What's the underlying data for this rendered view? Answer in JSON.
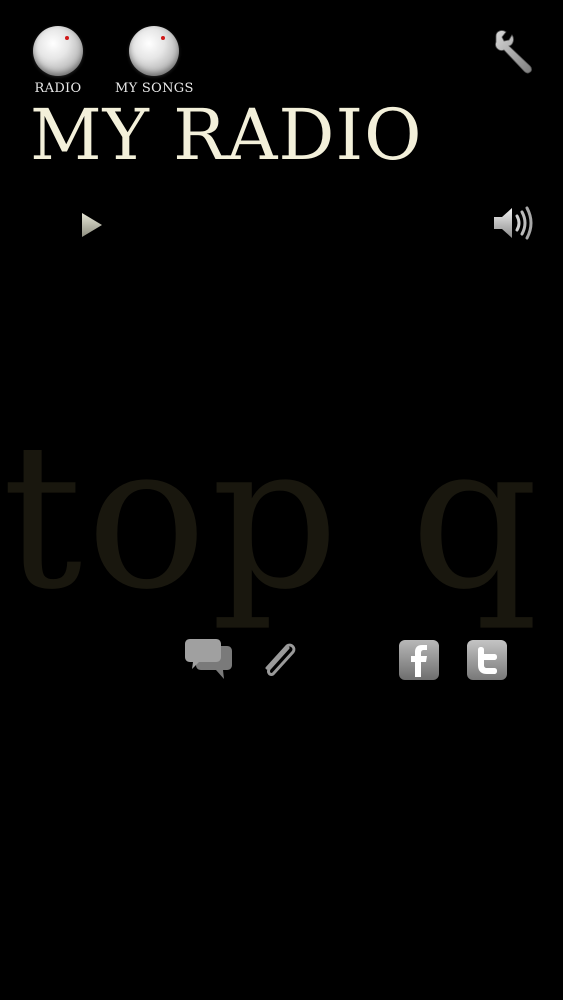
{
  "header": {
    "radio_label": "RADIO",
    "my_songs_label": "MY SONGS",
    "settings_icon": "wrench-icon"
  },
  "title": "MY RADIO",
  "player": {
    "play_icon": "play-icon",
    "volume_icon": "speaker-volume-icon"
  },
  "now_playing": "top q",
  "actions": {
    "comments_icon": "speech-bubbles-icon",
    "attach_icon": "paperclip-icon",
    "facebook_icon": "facebook-icon",
    "twitter_icon": "twitter-icon"
  },
  "colors": {
    "background": "#000000",
    "title": "#f3f0da",
    "ghost_text": "#19170e",
    "knob_indicator": "#d01818"
  }
}
